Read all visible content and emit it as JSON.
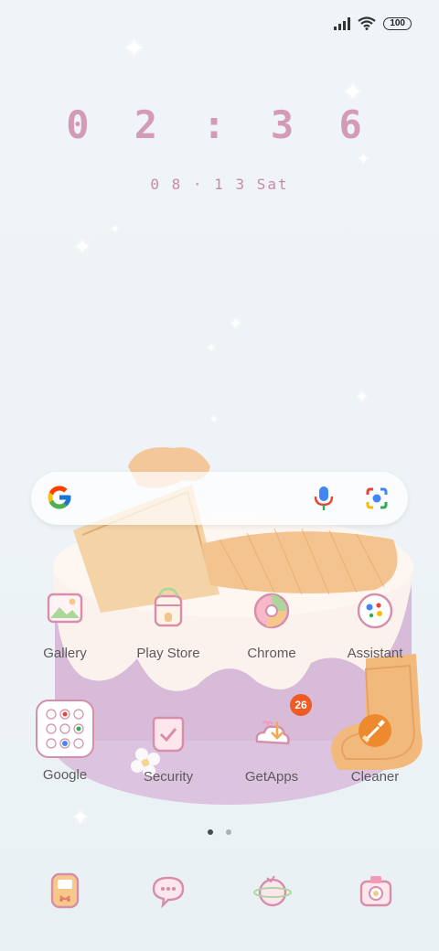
{
  "status_bar": {
    "battery": "100"
  },
  "lock": {
    "time": "0 2 : 3 6",
    "date": "0 8 · 1 3  Sat"
  },
  "icons": {
    "signal": "signal-icon",
    "wifi": "wifi-icon",
    "google": "google-icon",
    "mic": "mic-icon",
    "lens": "lens-icon"
  },
  "apps_row1": [
    {
      "label": "Gallery",
      "icon": "gallery-icon"
    },
    {
      "label": "Play Store",
      "icon": "play-store-icon"
    },
    {
      "label": "Chrome",
      "icon": "chrome-icon"
    },
    {
      "label": "Assistant",
      "icon": "assistant-icon"
    }
  ],
  "apps_row2": [
    {
      "label": "Google",
      "icon": "google-folder-icon"
    },
    {
      "label": "Security",
      "icon": "security-icon"
    },
    {
      "label": "GetApps",
      "icon": "getapps-icon",
      "badge": "26"
    },
    {
      "label": "Cleaner",
      "icon": "cleaner-icon"
    }
  ],
  "pages": {
    "count": 2,
    "active": 1
  },
  "dock": [
    {
      "icon": "phone-icon"
    },
    {
      "icon": "messages-icon"
    },
    {
      "icon": "browser-icon"
    },
    {
      "icon": "camera-icon"
    }
  ]
}
